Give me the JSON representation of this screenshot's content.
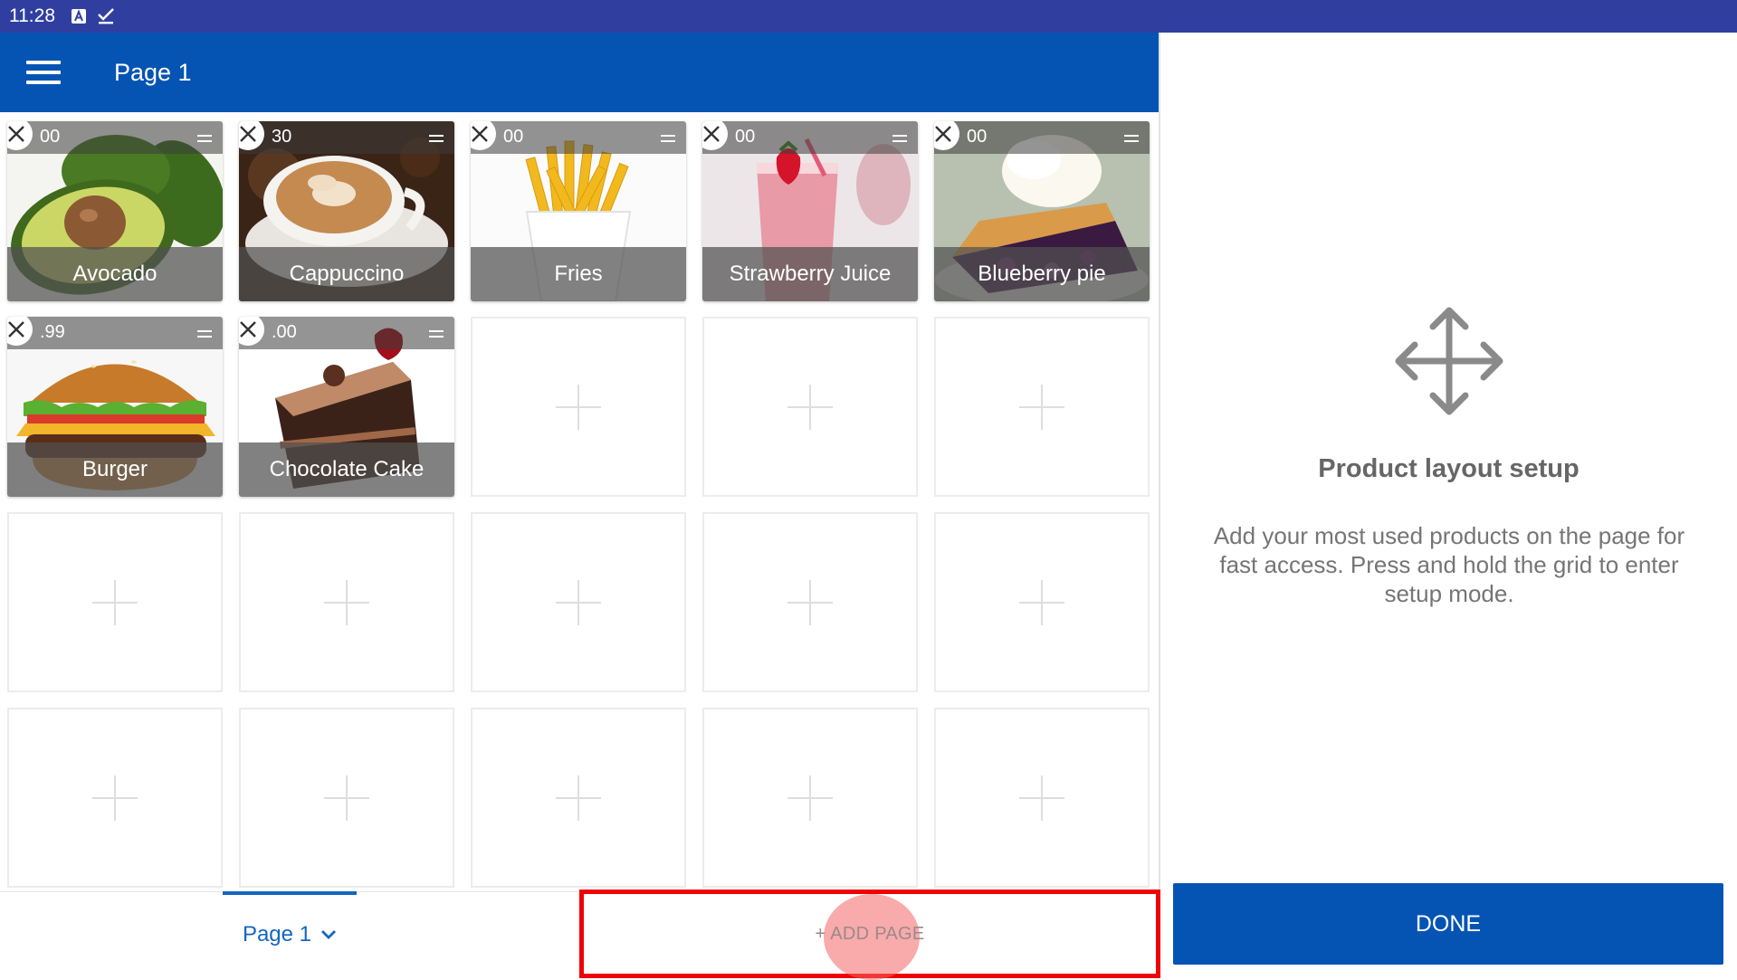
{
  "status_bar": {
    "time": "11:28"
  },
  "app_bar": {
    "title": "Page 1"
  },
  "products": [
    {
      "name": "Avocado",
      "price": "00"
    },
    {
      "name": "Cappuccino",
      "price": "30"
    },
    {
      "name": "Fries",
      "price": "00"
    },
    {
      "name": "Strawberry Juice",
      "price": "00"
    },
    {
      "name": "Blueberry pie",
      "price": "00"
    },
    {
      "name": "Burger",
      "price": ".99"
    },
    {
      "name": "Chocolate Cake",
      "price": ".00"
    }
  ],
  "bottom_bar": {
    "page_tab_label": "Page 1",
    "add_page_label": "+ ADD PAGE"
  },
  "setup_panel": {
    "title": "Product layout setup",
    "description": "Add your most used products on the page for fast access. Press and hold the grid to enter setup mode.",
    "done_label": "DONE"
  },
  "colors": {
    "status_bar": "#303F9F",
    "app_bar": "#0554B4",
    "highlight": "#F00000",
    "tab_text": "#1565C0"
  }
}
